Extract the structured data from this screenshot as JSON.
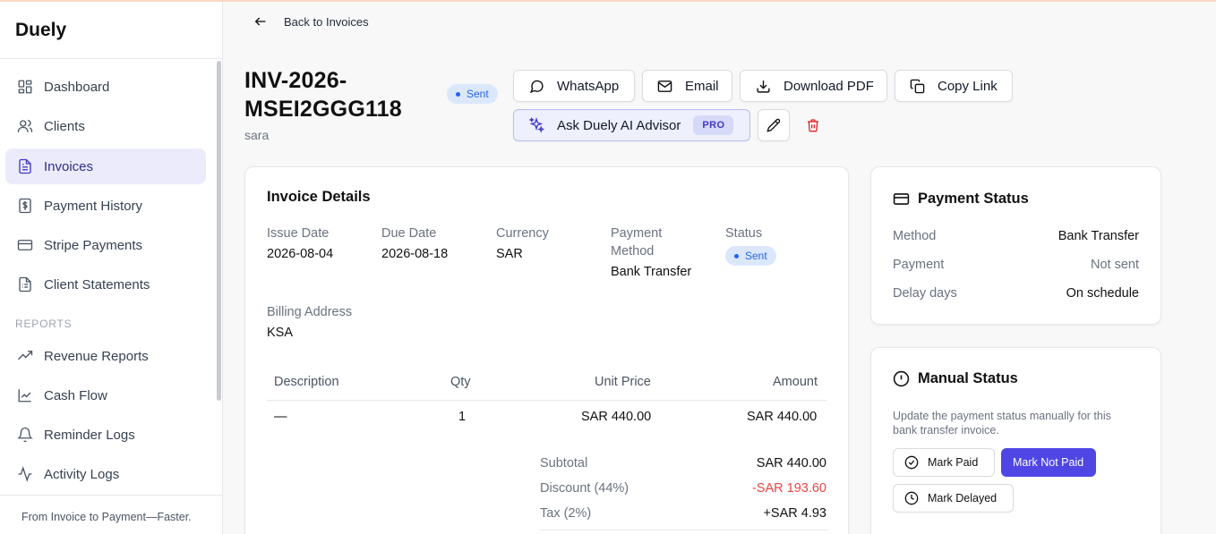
{
  "app": {
    "name": "Duely",
    "tagline": "From Invoice to Payment—Faster."
  },
  "sidebar": {
    "items": [
      {
        "label": "Dashboard",
        "icon": "grid-icon"
      },
      {
        "label": "Clients",
        "icon": "users-icon"
      },
      {
        "label": "Invoices",
        "icon": "file-text-icon",
        "active": true
      },
      {
        "label": "Payment History",
        "icon": "dollar-receipt-icon"
      },
      {
        "label": "Stripe Payments",
        "icon": "card-icon"
      }
    ],
    "items2": [
      {
        "label": "Client Statements",
        "icon": "statement-icon"
      }
    ],
    "section_reports": "REPORTS",
    "report_items": [
      {
        "label": "Revenue Reports",
        "icon": "trending-up-icon"
      },
      {
        "label": "Cash Flow",
        "icon": "line-chart-icon"
      },
      {
        "label": "Reminder Logs",
        "icon": "bell-icon"
      },
      {
        "label": "Activity Logs",
        "icon": "activity-icon"
      }
    ]
  },
  "header": {
    "back_label": "Back to Invoices",
    "invoice_number": "INV-2026-MSEI2GGG118",
    "client": "sara",
    "status_badge": "Sent"
  },
  "actions": {
    "whatsapp": "WhatsApp",
    "email": "Email",
    "download_pdf": "Download PDF",
    "copy_link": "Copy Link",
    "ai_advisor": "Ask Duely AI Advisor",
    "pro_badge": "PRO"
  },
  "invoice_details": {
    "title": "Invoice Details",
    "issue_date_label": "Issue Date",
    "issue_date": "2026-08-04",
    "due_date_label": "Due Date",
    "due_date": "2026-08-18",
    "currency_label": "Currency",
    "currency": "SAR",
    "payment_method_label": "Payment Method",
    "payment_method": "Bank Transfer",
    "status_label": "Status",
    "status": "Sent",
    "billing_address_label": "Billing Address",
    "billing_address": "KSA"
  },
  "line_items": {
    "headers": {
      "description": "Description",
      "qty": "Qty",
      "unit_price": "Unit Price",
      "amount": "Amount"
    },
    "rows": [
      {
        "description": "—",
        "qty": "1",
        "unit_price": "SAR 440.00",
        "amount": "SAR 440.00"
      }
    ]
  },
  "totals": {
    "subtotal_label": "Subtotal",
    "subtotal": "SAR 440.00",
    "discount_label": "Discount (44%)",
    "discount": "-SAR 193.60",
    "tax_label": "Tax (2%)",
    "tax": "+SAR 4.93"
  },
  "payment_status": {
    "title": "Payment Status",
    "method_label": "Method",
    "method": "Bank Transfer",
    "payment_label": "Payment",
    "payment": "Not sent",
    "delay_label": "Delay days",
    "delay": "On schedule"
  },
  "manual_status": {
    "title": "Manual Status",
    "description": "Update the payment status manually for this bank transfer invoice.",
    "mark_paid": "Mark Paid",
    "mark_not_paid": "Mark Not Paid",
    "mark_delayed": "Mark Delayed"
  },
  "colors": {
    "accent": "#4f46e5",
    "active_nav_bg": "#ebebfb",
    "badge_bg": "#dbe8fb",
    "badge_text": "#2563eb",
    "discount_red": "#ef4444",
    "delete_red": "#dc2626"
  }
}
